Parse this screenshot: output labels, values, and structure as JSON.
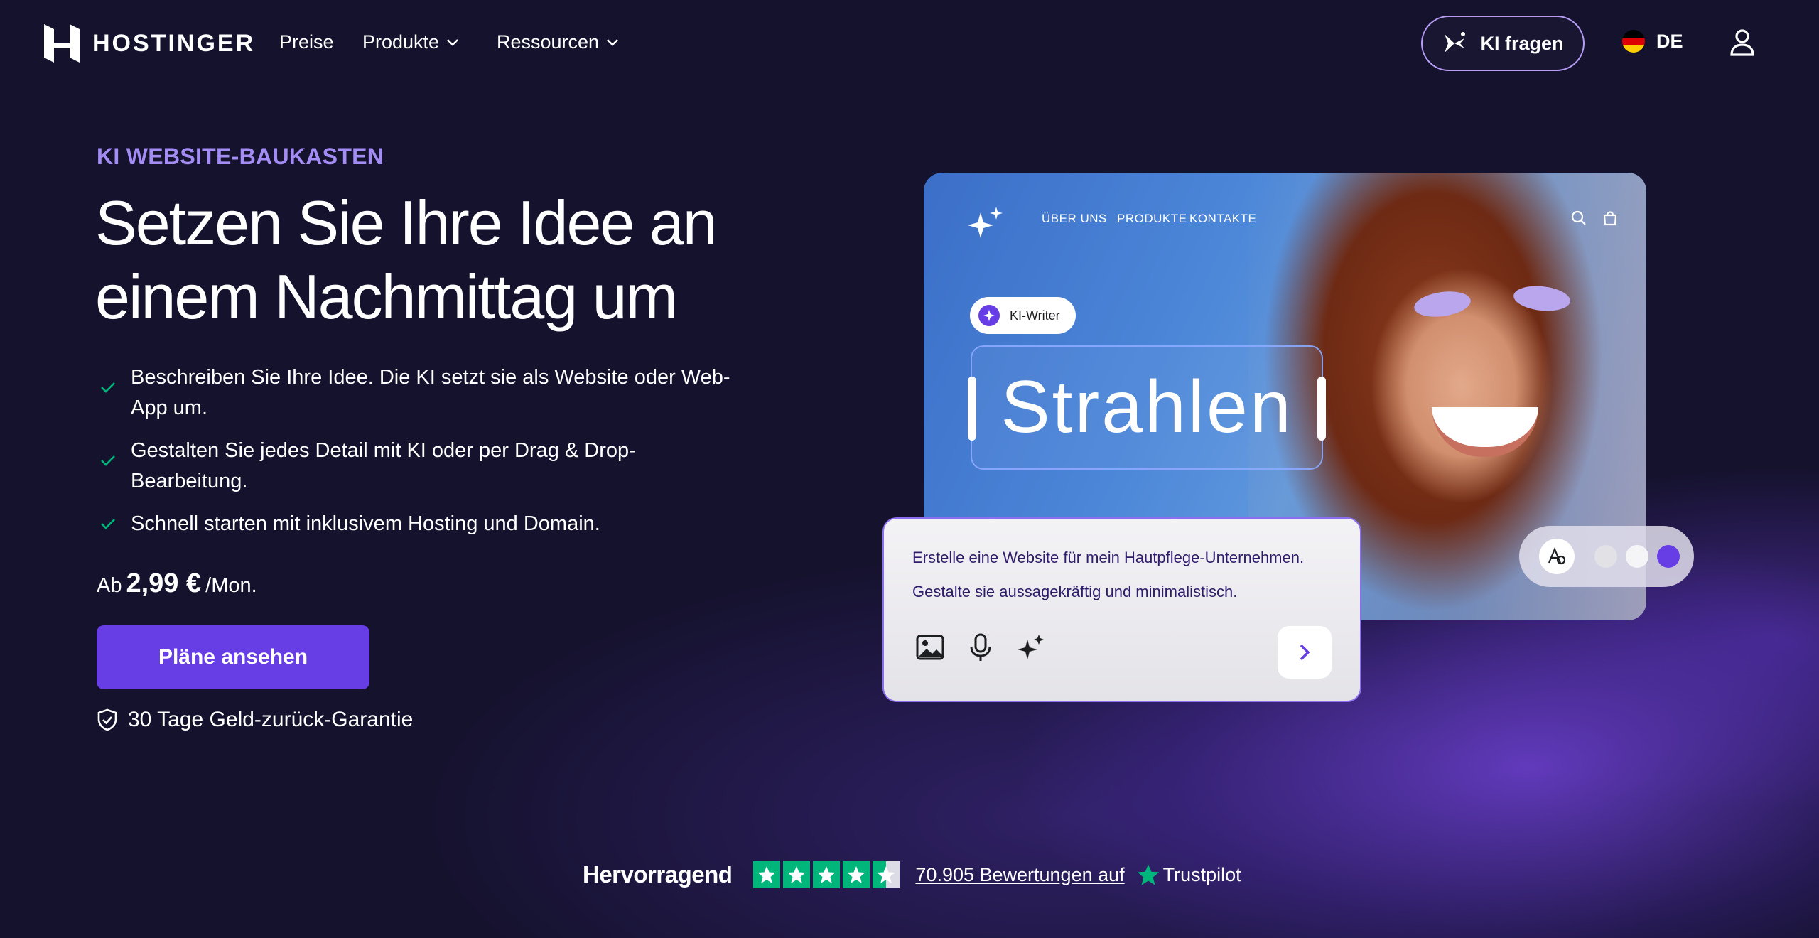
{
  "brand": {
    "name": "HOSTINGER"
  },
  "nav": {
    "links": [
      {
        "label": "Preise",
        "dropdown": false
      },
      {
        "label": "Produkte",
        "dropdown": true
      },
      {
        "label": "Ressourcen",
        "dropdown": true
      }
    ],
    "ki_button": "KI fragen",
    "language": "DE"
  },
  "hero": {
    "eyebrow": "KI WEBSITE-BAUKASTEN",
    "headline_line1": "Setzen Sie Ihre Idee an",
    "headline_line2": "einem Nachmittag um",
    "features": [
      "Beschreiben Sie Ihre Idee. Die KI setzt sie als Website oder Web-App um.",
      "Gestalten Sie jedes Detail mit KI oder per Drag & Drop-Bearbeitung.",
      "Schnell starten mit inklusivem Hosting und Domain."
    ],
    "price_prefix": "Ab",
    "price_amount": "2,99 €",
    "price_suffix": "/Mon.",
    "cta": "Pläne ansehen",
    "guarantee": "30 Tage Geld-zurück-Garantie"
  },
  "preview": {
    "nav_items": [
      "ÜBER UNS",
      "PRODUKTE",
      "KONTAKTE"
    ],
    "ki_writer_label": "KI-Writer",
    "headline_text": "Strahlen",
    "prompt_line1": "Erstelle eine Website für mein Hautpflege-Unternehmen.",
    "prompt_line2": "Gestalte sie aussagekräftig und minimalistisch.",
    "swatch_colors": [
      "#e1e1e6",
      "#f5f5f7",
      "#673de6"
    ]
  },
  "trustpilot": {
    "rating_label": "Hervorragend",
    "stars": 4.5,
    "reviews_text": "70.905 Bewertungen auf",
    "platform": "Trustpilot"
  },
  "colors": {
    "background": "#15122e",
    "accent": "#673de6",
    "eyebrow": "#a48cf5",
    "check": "#00b67a",
    "trustpilot_green": "#00b67a"
  }
}
